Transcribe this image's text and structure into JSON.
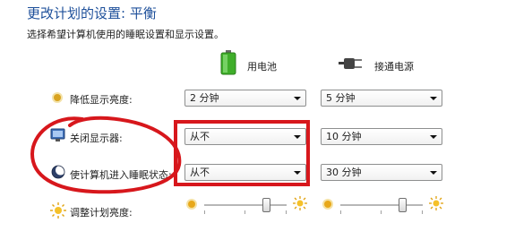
{
  "header": {
    "title": "更改计划的设置: 平衡",
    "subtitle": "选择希望计算机使用的睡眠设置和显示设置。"
  },
  "columns": {
    "battery_label": "用电池",
    "plugged_label": "接通电源"
  },
  "rows": {
    "dim_display": {
      "label": "降低显示亮度:",
      "battery": "2 分钟",
      "plugged": "5 分钟"
    },
    "turn_off_display": {
      "label": "关闭显示器:",
      "battery": "从不",
      "plugged": "10 分钟"
    },
    "sleep": {
      "label": "使计算机进入睡眠状态:",
      "battery": "从不",
      "plugged": "30 分钟"
    },
    "brightness": {
      "label": "调整计划亮度:",
      "battery_level": 0.78,
      "plugged_level": 0.78
    }
  },
  "icons": {
    "dim": "dim-brightness-icon",
    "display": "monitor-icon",
    "sleep": "moon-icon",
    "brightness": "sun-icon",
    "battery": "battery-icon",
    "plug": "power-plug-icon"
  },
  "colors": {
    "title": "#1d4f9a",
    "annotation_red": "#d7171c",
    "battery_green": "#3fae2a"
  }
}
